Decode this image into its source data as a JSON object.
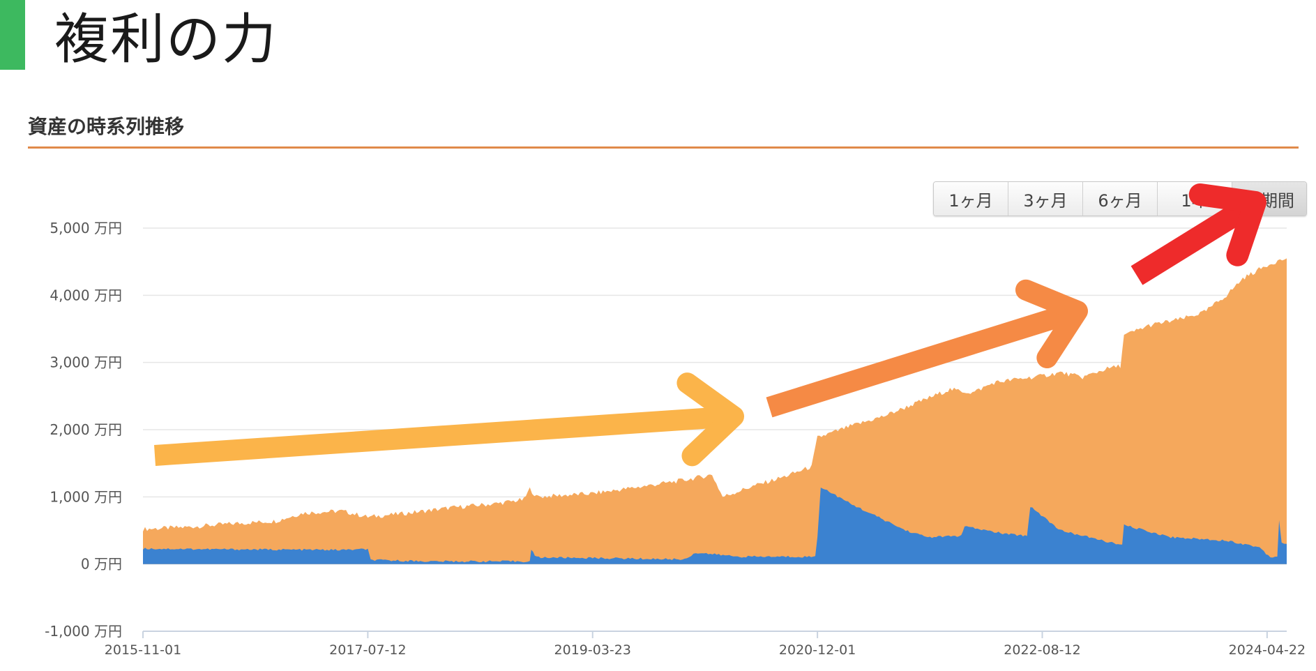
{
  "slide": {
    "title": "複利の力"
  },
  "section": {
    "title": "資産の時系列推移"
  },
  "range_buttons": [
    {
      "label": "1ヶ月",
      "active": false
    },
    {
      "label": "3ヶ月",
      "active": false
    },
    {
      "label": "6ヶ月",
      "active": false
    },
    {
      "label": "1年",
      "active": false
    },
    {
      "label": "全期間",
      "active": true
    }
  ],
  "colors": {
    "title_accent": "#3db95f",
    "section_rule": "#e08a4a",
    "total_assets_area": "#f5a85c",
    "cash_area": "#3b82d0",
    "arrow_1": "#fbb44a",
    "arrow_2": "#f58a45",
    "arrow_3": "#ee2b2b"
  },
  "chart_data": {
    "type": "area",
    "y_unit": "万円",
    "ylim": [
      -1000,
      5000
    ],
    "y_ticks": [
      "5,000 万円",
      "4,000 万円",
      "3,000 万円",
      "2,000 万円",
      "1,000 万円",
      "0 万円",
      "-1,000 万円"
    ],
    "y_tick_values": [
      5000,
      4000,
      3000,
      2000,
      1000,
      0,
      -1000
    ],
    "x_ticks": [
      "2015-11-01",
      "2017-07-12",
      "2019-03-23",
      "2020-12-01",
      "2022-08-12",
      "2024-04-22"
    ],
    "x_range": [
      "2015-11-01",
      "2024-06-15"
    ],
    "grid": true,
    "legend": "none",
    "series": [
      {
        "color_key": "total_assets_area",
        "points": [
          [
            "2015-11-01",
            520
          ],
          [
            "2016-03-01",
            550
          ],
          [
            "2016-07-01",
            600
          ],
          [
            "2016-11-01",
            640
          ],
          [
            "2017-01-15",
            760
          ],
          [
            "2017-05-01",
            790
          ],
          [
            "2017-07-12",
            700
          ],
          [
            "2017-11-01",
            760
          ],
          [
            "2018-03-01",
            840
          ],
          [
            "2018-07-01",
            900
          ],
          [
            "2018-09-15",
            960
          ],
          [
            "2018-10-01",
            1120
          ],
          [
            "2018-10-20",
            1000
          ],
          [
            "2019-03-23",
            1050
          ],
          [
            "2019-08-01",
            1150
          ],
          [
            "2019-12-01",
            1250
          ],
          [
            "2020-02-15",
            1330
          ],
          [
            "2020-03-15",
            1000
          ],
          [
            "2020-06-01",
            1150
          ],
          [
            "2020-09-01",
            1300
          ],
          [
            "2020-11-15",
            1450
          ],
          [
            "2020-12-01",
            1880
          ],
          [
            "2021-03-01",
            2050
          ],
          [
            "2021-06-01",
            2200
          ],
          [
            "2021-09-01",
            2400
          ],
          [
            "2021-12-01",
            2600
          ],
          [
            "2022-02-01",
            2550
          ],
          [
            "2022-04-01",
            2700
          ],
          [
            "2022-06-01",
            2750
          ],
          [
            "2022-08-12",
            2800
          ],
          [
            "2022-10-01",
            2850
          ],
          [
            "2022-12-01",
            2780
          ],
          [
            "2023-02-01",
            2900
          ],
          [
            "2023-03-15",
            2950
          ],
          [
            "2023-03-25",
            3400
          ],
          [
            "2023-06-01",
            3550
          ],
          [
            "2023-09-01",
            3650
          ],
          [
            "2023-11-01",
            3750
          ],
          [
            "2024-01-01",
            4000
          ],
          [
            "2024-02-15",
            4250
          ],
          [
            "2024-04-22",
            4450
          ],
          [
            "2024-05-15",
            4500
          ],
          [
            "2024-06-15",
            4550
          ]
        ]
      },
      {
        "color_key": "cash_area",
        "points": [
          [
            "2015-11-01",
            230
          ],
          [
            "2016-06-01",
            220
          ],
          [
            "2017-05-01",
            210
          ],
          [
            "2017-07-12",
            220
          ],
          [
            "2017-07-20",
            60
          ],
          [
            "2018-01-01",
            40
          ],
          [
            "2018-10-01",
            40
          ],
          [
            "2018-10-05",
            210
          ],
          [
            "2018-10-20",
            100
          ],
          [
            "2019-03-23",
            90
          ],
          [
            "2019-12-01",
            70
          ],
          [
            "2020-01-01",
            170
          ],
          [
            "2020-05-01",
            110
          ],
          [
            "2020-11-25",
            110
          ],
          [
            "2020-12-01",
            400
          ],
          [
            "2020-12-10",
            1150
          ],
          [
            "2021-03-01",
            900
          ],
          [
            "2021-08-01",
            500
          ],
          [
            "2021-10-01",
            400
          ],
          [
            "2022-01-01",
            420
          ],
          [
            "2022-01-10",
            560
          ],
          [
            "2022-05-01",
            450
          ],
          [
            "2022-07-01",
            420
          ],
          [
            "2022-07-10",
            860
          ],
          [
            "2022-10-01",
            500
          ],
          [
            "2023-03-20",
            280
          ],
          [
            "2023-03-25",
            580
          ],
          [
            "2023-08-01",
            400
          ],
          [
            "2024-01-01",
            350
          ],
          [
            "2024-04-01",
            250
          ],
          [
            "2024-05-01",
            100
          ],
          [
            "2024-05-20",
            120
          ],
          [
            "2024-05-25",
            650
          ],
          [
            "2024-06-01",
            320
          ],
          [
            "2024-06-15",
            300
          ]
        ]
      }
    ]
  }
}
